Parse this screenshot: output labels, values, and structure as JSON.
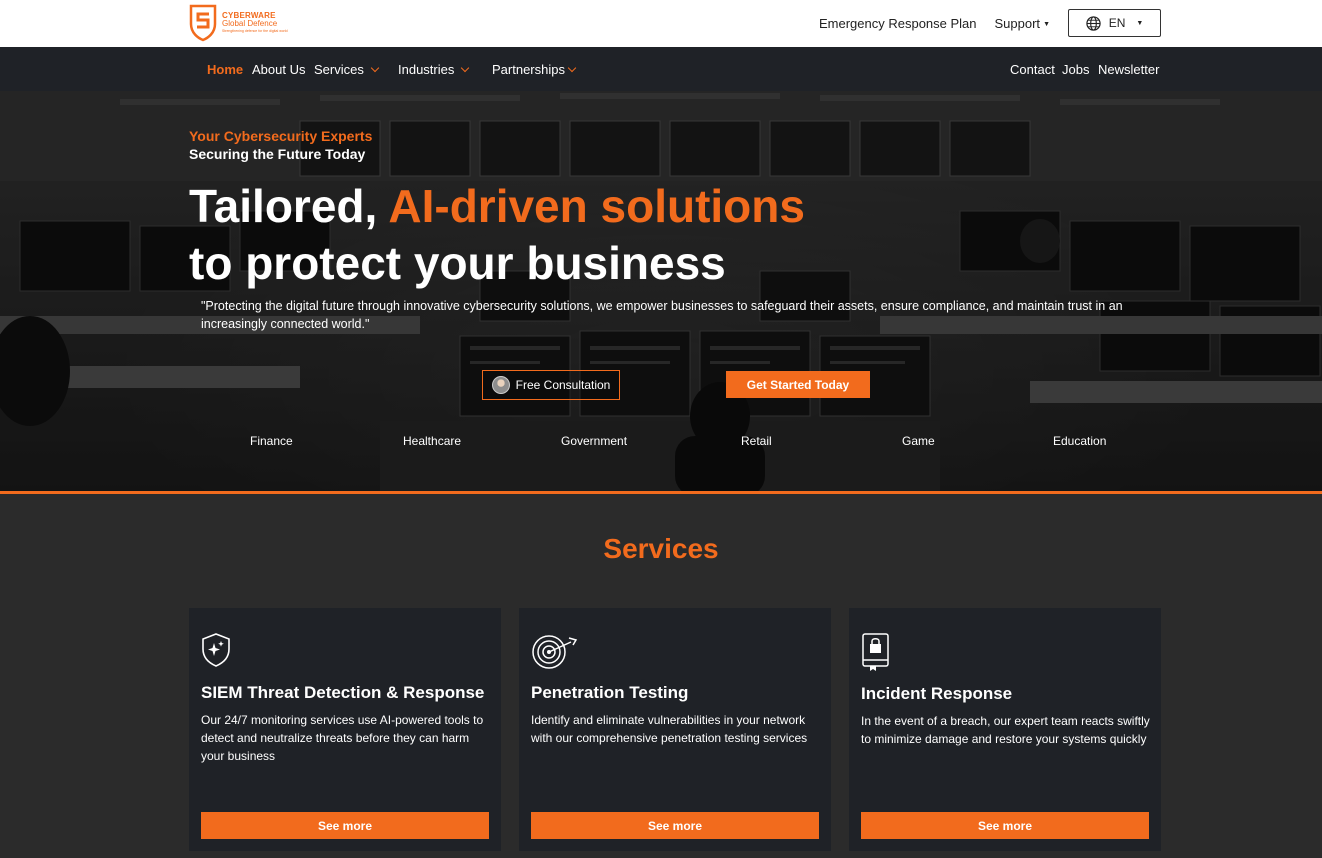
{
  "brand": {
    "name": "CYBERWARE",
    "subname": "Global Defence",
    "tagline": "Strengthening defence for the digital world"
  },
  "topbar": {
    "emergency": "Emergency Response Plan",
    "support": "Support",
    "language": "EN"
  },
  "nav": {
    "home": "Home",
    "about": "About Us",
    "services": "Services",
    "industries": "Industries",
    "partnerships": "Partnerships",
    "contact": "Contact",
    "jobs": "Jobs",
    "newsletter": "Newsletter"
  },
  "hero": {
    "kicker": "Your Cybersecurity Experts",
    "kicker2": "Securing the Future Today",
    "headline_part1": "Tailored, ",
    "headline_accent": "AI-driven solutions",
    "headline_line2": "to protect your business",
    "quote": "\"Protecting the digital future through innovative cybersecurity solutions, we empower businesses to safeguard their assets, ensure compliance, and maintain trust in an increasingly connected world.\"",
    "consult_label": "Free Consultation",
    "start_label": "Get Started Today",
    "industries": [
      "Finance",
      "Healthcare",
      "Government",
      "Retail",
      "Game",
      "Education"
    ]
  },
  "services": {
    "title": "Services",
    "cards": [
      {
        "icon": "shield-sparkle-icon",
        "title": "SIEM Threat Detection & Response",
        "desc": "Our 24/7 monitoring services use AI-powered tools to detect and neutralize threats before they can harm your business",
        "button": "See more"
      },
      {
        "icon": "target-arrow-icon",
        "title": "Penetration Testing",
        "desc": "Identify and eliminate vulnerabilities in your network with our comprehensive penetration testing services",
        "button": "See more"
      },
      {
        "icon": "lock-book-icon",
        "title": "Incident Response",
        "desc": "In the event of a breach, our expert team reacts swiftly to minimize damage and restore your systems quickly",
        "button": "See more"
      }
    ]
  },
  "colors": {
    "accent": "#f26b1d",
    "nav_bg": "#1f2227",
    "page_bg": "#2b2b2b",
    "card_bg": "#1f2227"
  }
}
